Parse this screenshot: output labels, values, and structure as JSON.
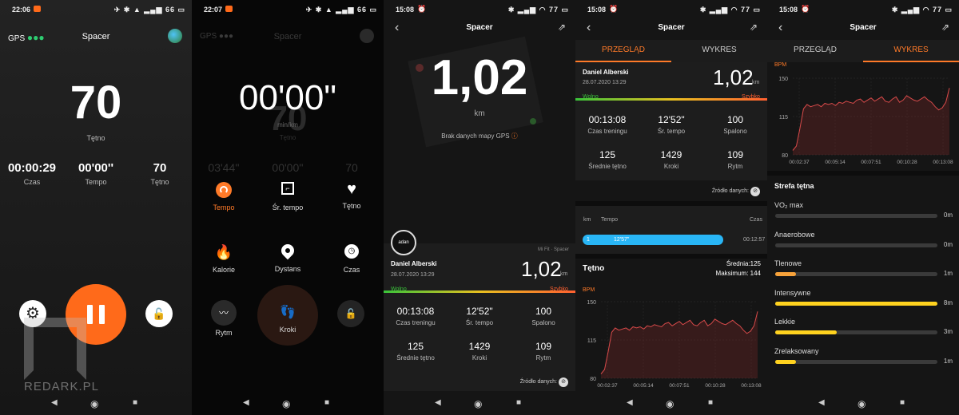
{
  "watermark": "REDARK.PL",
  "screen1": {
    "status_time": "22:06",
    "status_right": "66",
    "gps_label": "GPS",
    "title": "Spacer",
    "heart_value": "70",
    "heart_label": "Tętno",
    "stats": [
      {
        "value": "00:00:29",
        "label": "Czas"
      },
      {
        "value": "00'00''",
        "label": "Tempo"
      },
      {
        "value": "70",
        "label": "Tętno"
      }
    ]
  },
  "screen2": {
    "status_time": "22:07",
    "status_right": "66",
    "gps_label": "GPS",
    "title": "Spacer",
    "timer": "00'00\"",
    "ghost_value": "70",
    "ghost_unit": "min/km",
    "ghost_label": "Tętno",
    "ghost_stats": [
      "03'44''",
      "00'00''",
      "70"
    ],
    "menu": [
      {
        "label": "Tempo",
        "active": true
      },
      {
        "label": "Śr. tempo"
      },
      {
        "label": "Tętno"
      },
      {
        "label": "Kalorie"
      },
      {
        "label": "Dystans"
      },
      {
        "label": "Czas"
      },
      {
        "label": "Rytm"
      },
      {
        "label": "Kroki"
      }
    ]
  },
  "screen3": {
    "status_time": "15:08",
    "status_right": "77",
    "title": "Spacer",
    "distance": "1,02",
    "distance_unit": "km",
    "no_map": "Brak danych mapy GPS",
    "source_device": "Mi Fit · Spacer",
    "user": "Daniel Alberski",
    "date": "28.07.2020 13:29",
    "dist_small": "1,02",
    "dist_small_unit": "km",
    "gauge_left": "Wolno",
    "gauge_right": "Szybko",
    "stats": [
      {
        "value": "00:13:08",
        "label": "Czas treningu"
      },
      {
        "value": "12'52\"",
        "label": "Śr. tempo"
      },
      {
        "value": "100",
        "label": "Spalono"
      },
      {
        "value": "125",
        "label": "Średnie tętno"
      },
      {
        "value": "1429",
        "label": "Kroki"
      },
      {
        "value": "109",
        "label": "Rytm"
      }
    ],
    "source_label": "Źródło danych:"
  },
  "screen4": {
    "status_time": "15:08",
    "status_right": "77",
    "title": "Spacer",
    "tabs": [
      "PRZEGLĄD",
      "WYKRES"
    ],
    "user": "Daniel Alberski",
    "date": "28.07.2020 13:29",
    "distance": "1,02",
    "distance_unit": "km",
    "gauge_left": "Wolno",
    "gauge_right": "Szybko",
    "stats": [
      {
        "value": "00:13:08",
        "label": "Czas treningu"
      },
      {
        "value": "12'52\"",
        "label": "Śr. tempo"
      },
      {
        "value": "100",
        "label": "Spalono"
      },
      {
        "value": "125",
        "label": "Średnie tętno"
      },
      {
        "value": "1429",
        "label": "Kroki"
      },
      {
        "value": "109",
        "label": "Rytm"
      }
    ],
    "source_label": "Źródło danych:",
    "splits": {
      "col_km": "km",
      "col_tempo": "Tempo",
      "col_czas": "Czas",
      "row_km": "1",
      "row_tempo": "12'57\"",
      "row_czas": "00:12:57"
    },
    "hr_title": "Tętno",
    "hr_avg": "Średnia:125",
    "hr_max": "Maksimum: 144",
    "hr_unit": "BPM"
  },
  "screen5": {
    "status_time": "15:08",
    "status_right": "77",
    "title": "Spacer",
    "tabs": [
      "PRZEGLĄD",
      "WYKRES"
    ],
    "hr_unit": "BPM",
    "zones_title": "Strefa tętna",
    "zones": [
      {
        "label": "VO₂ max",
        "time": "0m",
        "fraction": 0,
        "color": "#ffd21f"
      },
      {
        "label": "Anaerobowe",
        "time": "0m",
        "fraction": 0,
        "color": "#ffd21f"
      },
      {
        "label": "Tlenowe",
        "time": "1m",
        "fraction": 0.13,
        "color": "#f7a23a"
      },
      {
        "label": "Intensywne",
        "time": "8m",
        "fraction": 1.0,
        "color": "#ffd21f"
      },
      {
        "label": "Lekkie",
        "time": "3m",
        "fraction": 0.38,
        "color": "#ffd21f"
      },
      {
        "label": "Zrelaksowany",
        "time": "1m",
        "fraction": 0.13,
        "color": "#ffd21f"
      }
    ]
  },
  "colors": {
    "accent": "#ff7a28",
    "pause_button": "#ff6a1a",
    "split_bar": "#29b6f6",
    "chart_line": "#d84a4a"
  },
  "chart_data": {
    "type": "area",
    "title": "",
    "xlabel": "",
    "ylabel": "BPM",
    "ylim": [
      80,
      150
    ],
    "yticks": [
      "80",
      "115",
      "150"
    ],
    "xticks": [
      "00:02:37",
      "00:05:14",
      "00:07:51",
      "00:10:28",
      "00:13:08"
    ],
    "series": [
      {
        "values": [
          84,
          88,
          104,
          122,
          126,
          124,
          125,
          126,
          124,
          127,
          126,
          127,
          125,
          128,
          127,
          129,
          128,
          127,
          130,
          131,
          128,
          130,
          132,
          129,
          131,
          133,
          129,
          128,
          131,
          133,
          128,
          130,
          134,
          132,
          130,
          129,
          131,
          133,
          130,
          128,
          124,
          121,
          123,
          128,
          141
        ]
      }
    ]
  }
}
